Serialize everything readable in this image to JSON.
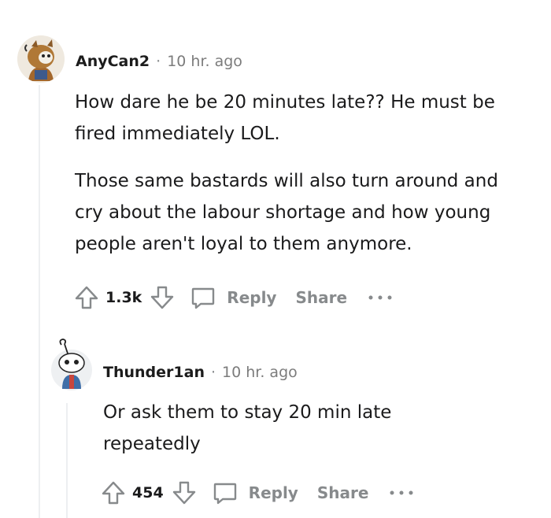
{
  "comments": [
    {
      "author": "AnyCan2",
      "time": "10 hr. ago",
      "paragraphs": [
        "How dare he be 20 minutes late?? He must be fired immediately LOL.",
        "Those same bastards will also turn around and cry about the labour shortage and how young people aren't loyal to them anymore."
      ],
      "votes": "1.3k",
      "reply_label": "Reply",
      "share_label": "Share"
    },
    {
      "author": "Thunder1an",
      "time": "10 hr. ago",
      "paragraphs": [
        "Or ask them to stay 20 min late repeatedly"
      ],
      "votes": "454",
      "reply_label": "Reply",
      "share_label": "Share"
    }
  ],
  "separator": "·",
  "colors": {
    "muted": "#878a8c",
    "thread_line": "#edeff1",
    "text": "#1a1a1b"
  }
}
